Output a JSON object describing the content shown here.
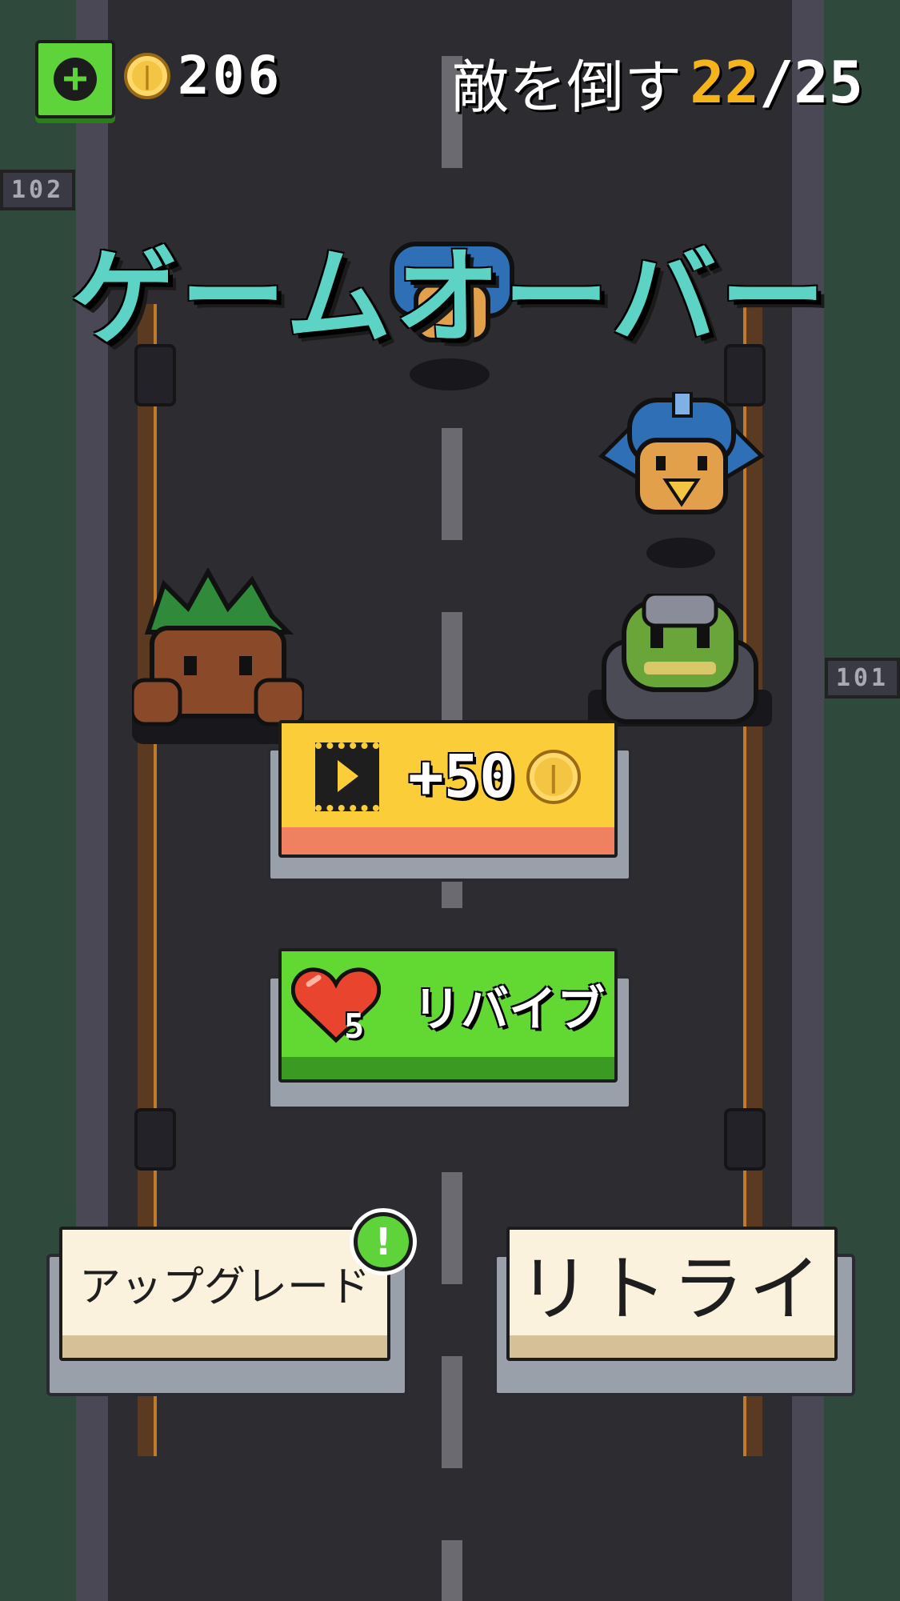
{
  "hud": {
    "add_icon": "plus-icon",
    "coin_icon": "coin-icon",
    "coins": "206",
    "task_label": "敵を倒す",
    "task_current": "22",
    "task_separator": "/",
    "task_total": "25"
  },
  "title": "ゲームオーバー",
  "road_signs": [
    "102",
    "101"
  ],
  "buttons": {
    "ad_reward": {
      "icon": "video-icon",
      "label": "+50",
      "reward_icon": "coin-icon"
    },
    "revive": {
      "icon": "heart-icon",
      "cost": "5",
      "label": "リバイブ"
    },
    "upgrade": {
      "label": "アップグレード",
      "badge": "!"
    },
    "retry": {
      "label": "リトライ"
    }
  },
  "colors": {
    "title": "#5cd3c4",
    "ad_button": "#fbcd38",
    "revive_button": "#62d832",
    "cream_button": "#fbf2de",
    "task_progress": "#f4b41a",
    "road": "#2d2c31"
  }
}
